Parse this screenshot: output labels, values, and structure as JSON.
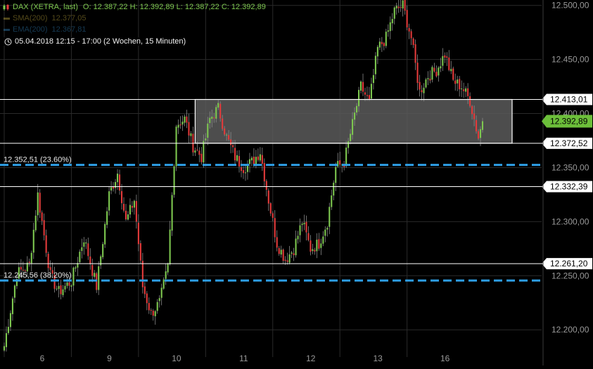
{
  "header": {
    "title": "DAX (XETRA, last)",
    "ohlc": "O: 12.387,22   H: 12.392,89   L: 12.387,22   C: 12.392,89",
    "sma_label": "SMA(200)",
    "sma_value": "12.377,05",
    "ema_label": "EMA(200)",
    "ema_value": "12.367,81",
    "range_text": "05.04.2018 12:15 - 17:00  (2 Wochen, 15 Minuten)",
    "icon": "candlestick-icon",
    "range_icon": "clock-icon"
  },
  "chart_data": {
    "type": "candlestick",
    "title": "DAX (XETRA, last)",
    "ylim": [
      12180,
      12505
    ],
    "y_ticks": [
      12200,
      12250,
      12300,
      12350,
      12400,
      12450,
      12500
    ],
    "y_tick_labels": [
      "12.200,00",
      "12.250,00",
      "12.300,00",
      "12.350,00",
      "12.400,00",
      "12.450,00",
      "12.500,00"
    ],
    "x_day_labels": [
      "6",
      "9",
      "10",
      "11",
      "12",
      "13",
      "16"
    ],
    "candles_per_day": 32,
    "day_boundaries": [
      {
        "label": "6",
        "index": 0
      },
      {
        "label": "9",
        "index": 32
      },
      {
        "label": "10",
        "index": 64
      },
      {
        "label": "11",
        "index": 96
      },
      {
        "label": "12",
        "index": 128
      },
      {
        "label": "13",
        "index": 160
      },
      {
        "label": "16",
        "index": 192
      }
    ],
    "close_anchors": [
      [
        0,
        12185
      ],
      [
        6,
        12252
      ],
      [
        12,
        12260
      ],
      [
        16,
        12325
      ],
      [
        22,
        12250
      ],
      [
        26,
        12235
      ],
      [
        32,
        12245
      ],
      [
        38,
        12285
      ],
      [
        44,
        12240
      ],
      [
        50,
        12325
      ],
      [
        54,
        12345
      ],
      [
        58,
        12300
      ],
      [
        62,
        12320
      ],
      [
        66,
        12240
      ],
      [
        70,
        12215
      ],
      [
        74,
        12225
      ],
      [
        78,
        12258
      ],
      [
        82,
        12390
      ],
      [
        86,
        12395
      ],
      [
        90,
        12370
      ],
      [
        94,
        12360
      ],
      [
        98,
        12395
      ],
      [
        102,
        12405
      ],
      [
        106,
        12378
      ],
      [
        110,
        12360
      ],
      [
        114,
        12350
      ],
      [
        118,
        12355
      ],
      [
        122,
        12365
      ],
      [
        126,
        12320
      ],
      [
        130,
        12280
      ],
      [
        134,
        12265
      ],
      [
        138,
        12275
      ],
      [
        142,
        12300
      ],
      [
        146,
        12275
      ],
      [
        150,
        12280
      ],
      [
        154,
        12300
      ],
      [
        158,
        12350
      ],
      [
        162,
        12355
      ],
      [
        166,
        12390
      ],
      [
        170,
        12425
      ],
      [
        174,
        12410
      ],
      [
        178,
        12460
      ],
      [
        182,
        12470
      ],
      [
        186,
        12495
      ],
      [
        190,
        12500
      ],
      [
        194,
        12470
      ],
      [
        198,
        12420
      ],
      [
        202,
        12435
      ],
      [
        206,
        12440
      ],
      [
        210,
        12455
      ],
      [
        214,
        12430
      ],
      [
        218,
        12425
      ],
      [
        222,
        12412
      ],
      [
        226,
        12378
      ],
      [
        228,
        12392.89
      ]
    ],
    "last_close": 12392.89,
    "last_close_label": "12.392,89",
    "zone": {
      "low": 12372.52,
      "high": 12413.01
    },
    "support_resistance_levels": [
      {
        "value": 12413.01,
        "label": "12.413,01"
      },
      {
        "value": 12372.52,
        "label": "12.372,52"
      },
      {
        "value": 12332.39,
        "label": "12.332,39"
      },
      {
        "value": 12261.2,
        "label": "12.261,20"
      }
    ],
    "fibonacci_levels": [
      {
        "value": 12352.51,
        "label": "12.352,51 (23.60%)"
      },
      {
        "value": 12245.56,
        "label": "12.245,56 (38.20%)"
      }
    ],
    "colors": {
      "background": "#000000",
      "grid": "#2a2a2a",
      "up": "#7ec850",
      "down": "#e33b3b",
      "fib_line": "#2e9fe6",
      "level_line": "#ffffff",
      "zone_fill": "#5a5a5a",
      "axis_text": "#9a9a9a",
      "last_price_tag": "#6cbf3a",
      "sma": "#b7a13a",
      "ema": "#2f7db3"
    }
  }
}
